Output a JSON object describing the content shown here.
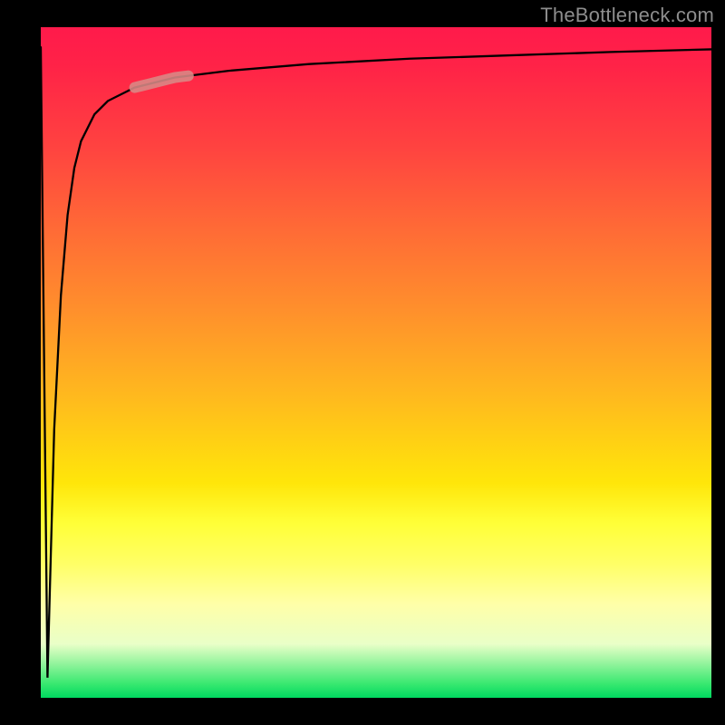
{
  "watermark": "TheBottleneck.com",
  "chart_data": {
    "type": "line",
    "title": "",
    "xlabel": "",
    "ylabel": "",
    "xlim": [
      0,
      100
    ],
    "ylim": [
      0,
      100
    ],
    "grid": false,
    "legend": false,
    "series": [
      {
        "name": "curve",
        "color": "#000000",
        "x": [
          0,
          1,
          2,
          3,
          4,
          5,
          6,
          8,
          10,
          14,
          20,
          28,
          40,
          55,
          70,
          85,
          100
        ],
        "values": [
          97,
          3,
          40,
          60,
          72,
          79,
          83,
          87,
          89,
          91,
          92.5,
          93.5,
          94.5,
          95.3,
          95.8,
          96.3,
          96.7
        ]
      }
    ],
    "highlight_segment": {
      "series": "curve",
      "x_start": 14,
      "x_end": 22,
      "color": "#d88a86"
    },
    "background_gradient": {
      "direction": "vertical",
      "stops": [
        {
          "pos": 0.0,
          "color": "#ff1a4b"
        },
        {
          "pos": 0.18,
          "color": "#ff4340"
        },
        {
          "pos": 0.42,
          "color": "#ff8f2c"
        },
        {
          "pos": 0.68,
          "color": "#ffe60a"
        },
        {
          "pos": 0.86,
          "color": "#ffffa8"
        },
        {
          "pos": 1.0,
          "color": "#00d860"
        }
      ]
    }
  }
}
